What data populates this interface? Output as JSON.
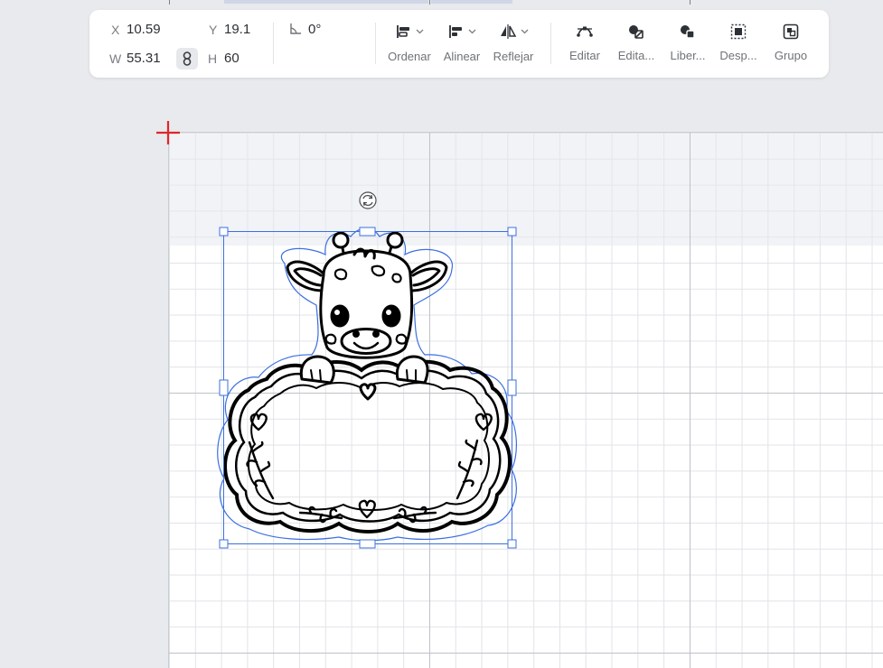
{
  "toolbar": {
    "x_label": "X",
    "x_value": "10.59",
    "y_label": "Y",
    "y_value": "19.1",
    "w_label": "W",
    "w_value": "55.31",
    "h_label": "H",
    "h_value": "60",
    "angle_value": "0°",
    "arrange": {
      "label": "Ordenar",
      "icon": "arrange-icon"
    },
    "align": {
      "label": "Alinear",
      "icon": "align-left-icon"
    },
    "flip": {
      "label": "Reflejar",
      "icon": "flip-icon"
    },
    "edit": {
      "label": "Editar",
      "icon": "edit-path-icon"
    },
    "edit_more": {
      "label": "Edita...",
      "icon": "edit-shape-icon"
    },
    "release": {
      "label": "Liber...",
      "icon": "release-icon"
    },
    "offset": {
      "label": "Desp...",
      "icon": "offset-icon"
    },
    "group": {
      "label": "Grupo",
      "icon": "group-icon"
    }
  },
  "colors": {
    "selection": "#3b6fe0",
    "origin_marker": "#e0262b",
    "artwork": "#000000"
  }
}
